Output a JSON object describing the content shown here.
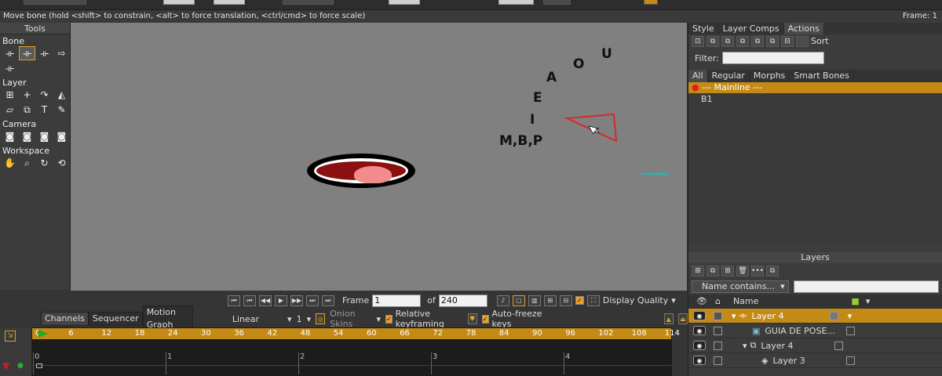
{
  "status": {
    "message": "Move bone (hold <shift> to constrain, <alt> to force translation, <ctrl/cmd> to force scale)",
    "frame_label": "Frame: 1"
  },
  "tools": {
    "title": "Tools",
    "sections": [
      "Bone",
      "Layer",
      "Camera",
      "Workspace"
    ]
  },
  "canvas": {
    "letters": [
      "U",
      "O",
      "A",
      "E",
      "I",
      "M,B,P"
    ]
  },
  "actions_panel": {
    "tabs": [
      "Style",
      "Layer Comps",
      "Actions"
    ],
    "sort_label": "Sort",
    "filter_label": "Filter:",
    "subtabs": [
      "All",
      "Regular",
      "Morphs",
      "Smart Bones"
    ],
    "items": [
      "--- Mainline ---",
      "B1"
    ]
  },
  "layers_panel": {
    "title": "Layers",
    "filter_select": "Name contains...",
    "name_header": "Name",
    "rows": [
      "Layer 4",
      "GUIA DE POSE...",
      "Layer 4",
      "Layer 3"
    ]
  },
  "transport": {
    "frame_label": "Frame",
    "frame_value": "1",
    "of_label": "of",
    "total_value": "240",
    "quality_label": "Display Quality"
  },
  "timeline": {
    "tabs": [
      "Channels",
      "Sequencer",
      "Motion Graph"
    ],
    "interp": "Linear",
    "interp_num": "1",
    "onion_label": "Onion Skins",
    "rel_label": "Relative keyframing",
    "auto_label": "Auto-freeze keys",
    "ruler_ticks": [
      "0",
      "6",
      "12",
      "18",
      "24",
      "30",
      "36",
      "42",
      "48",
      "54",
      "60",
      "66",
      "72",
      "78",
      "84",
      "90",
      "96",
      "102",
      "108",
      "114"
    ],
    "track_ticks": [
      "0",
      "1",
      "2",
      "3",
      "4"
    ]
  }
}
